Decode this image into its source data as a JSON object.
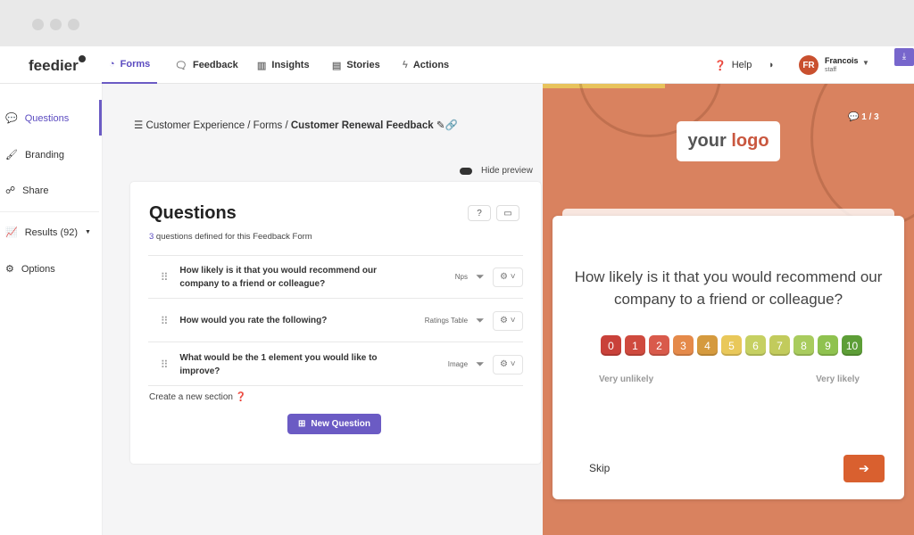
{
  "app": {
    "logo": "feedier"
  },
  "nav": [
    {
      "label": "Forms",
      "icon": "forms-icon"
    },
    {
      "label": "Feedback",
      "icon": "chat-icon"
    },
    {
      "label": "Insights",
      "icon": "chart-icon"
    },
    {
      "label": "Stories",
      "icon": "stories-icon"
    },
    {
      "label": "Actions",
      "icon": "bolt-icon"
    }
  ],
  "header": {
    "help": "Help",
    "user_initials": "FR",
    "user_name": "Francois",
    "user_role": "staff"
  },
  "sidebar": [
    {
      "label": "Questions"
    },
    {
      "label": "Branding"
    },
    {
      "label": "Share"
    },
    {
      "label": "Results (92)"
    },
    {
      "label": "Options"
    }
  ],
  "breadcrumb": {
    "path": "Customer Experience / Forms / ",
    "current": "Customer Renewal Feedback"
  },
  "hide_preview": "Hide preview",
  "questions": {
    "title": "Questions",
    "count": "3",
    "subtitle": " questions defined for this Feedback Form",
    "items": [
      {
        "text": "How likely is it that you would recommend our company to a friend or colleague?",
        "type": "Nps"
      },
      {
        "text": "How would you rate the following?",
        "type": "Ratings Table"
      },
      {
        "text": "What would be the 1 element you would like to improve?",
        "type": "Image"
      }
    ],
    "create_section": "Create a new section",
    "new_question": "New Question"
  },
  "preview": {
    "progress_percent": 33,
    "counter": "1 / 3",
    "logo_a": "your",
    "logo_b": "logo",
    "question": "How likely is it that you would recommend our company to a friend or colleague?",
    "scale": [
      "0",
      "1",
      "2",
      "3",
      "4",
      "5",
      "6",
      "7",
      "8",
      "9",
      "10"
    ],
    "scale_colors": [
      "#c9413a",
      "#cf4a3e",
      "#d95a4b",
      "#e58a4a",
      "#d59a3e",
      "#e9c85a",
      "#c6d062",
      "#c2cb5c",
      "#a9cc5e",
      "#8fc24f",
      "#5d9e37"
    ],
    "low_label": "Very unlikely",
    "high_label": "Very likely",
    "skip": "Skip",
    "accent": "#d9602f"
  },
  "colors": {
    "brand": "#6b5bc4",
    "preview_bg": "#d9825f"
  }
}
